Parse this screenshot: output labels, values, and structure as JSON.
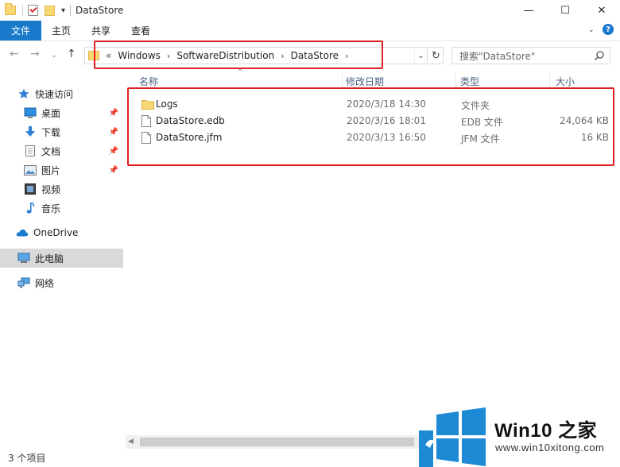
{
  "window": {
    "title": "DataStore",
    "controls": {
      "minimize": "—",
      "maximize": "☐",
      "close": "✕"
    }
  },
  "ribbon": {
    "tabs": [
      "文件",
      "主页",
      "共享",
      "查看"
    ],
    "help": "?"
  },
  "address": {
    "more": "«",
    "crumbs": [
      "Windows",
      "SoftwareDistribution",
      "DataStore"
    ]
  },
  "search": {
    "placeholder": "搜索\"DataStore\""
  },
  "sidebar": {
    "items": [
      {
        "label": "快速访问",
        "icon": "star-icon",
        "pinned": false
      },
      {
        "label": "桌面",
        "icon": "desktop-icon",
        "pinned": true
      },
      {
        "label": "下载",
        "icon": "download-icon",
        "pinned": true
      },
      {
        "label": "文档",
        "icon": "document-icon",
        "pinned": true
      },
      {
        "label": "图片",
        "icon": "picture-icon",
        "pinned": true
      },
      {
        "label": "视频",
        "icon": "video-icon",
        "pinned": false
      },
      {
        "label": "音乐",
        "icon": "music-icon",
        "pinned": false
      },
      {
        "label": "OneDrive",
        "icon": "cloud-icon",
        "pinned": false
      },
      {
        "label": "此电脑",
        "icon": "computer-icon",
        "pinned": false,
        "selected": true
      },
      {
        "label": "网络",
        "icon": "network-icon",
        "pinned": false
      }
    ]
  },
  "columns": {
    "name": "名称",
    "date": "修改日期",
    "type": "类型",
    "size": "大小"
  },
  "files": [
    {
      "name": "Logs",
      "date": "2020/3/18 14:30",
      "type": "文件夹",
      "size": "",
      "icon": "folder-icon"
    },
    {
      "name": "DataStore.edb",
      "date": "2020/3/16 18:01",
      "type": "EDB 文件",
      "size": "24,064 KB",
      "icon": "file-icon"
    },
    {
      "name": "DataStore.jfm",
      "date": "2020/3/13 16:50",
      "type": "JFM 文件",
      "size": "16 KB",
      "icon": "file-icon"
    }
  ],
  "status": {
    "item_count": "3 个项目"
  },
  "watermark": {
    "brand": "Win10 之家",
    "url": "www.win10xitong.com"
  },
  "colors": {
    "accent": "#1979ca",
    "highlight": "#e02020",
    "folder": "#f8d775"
  }
}
